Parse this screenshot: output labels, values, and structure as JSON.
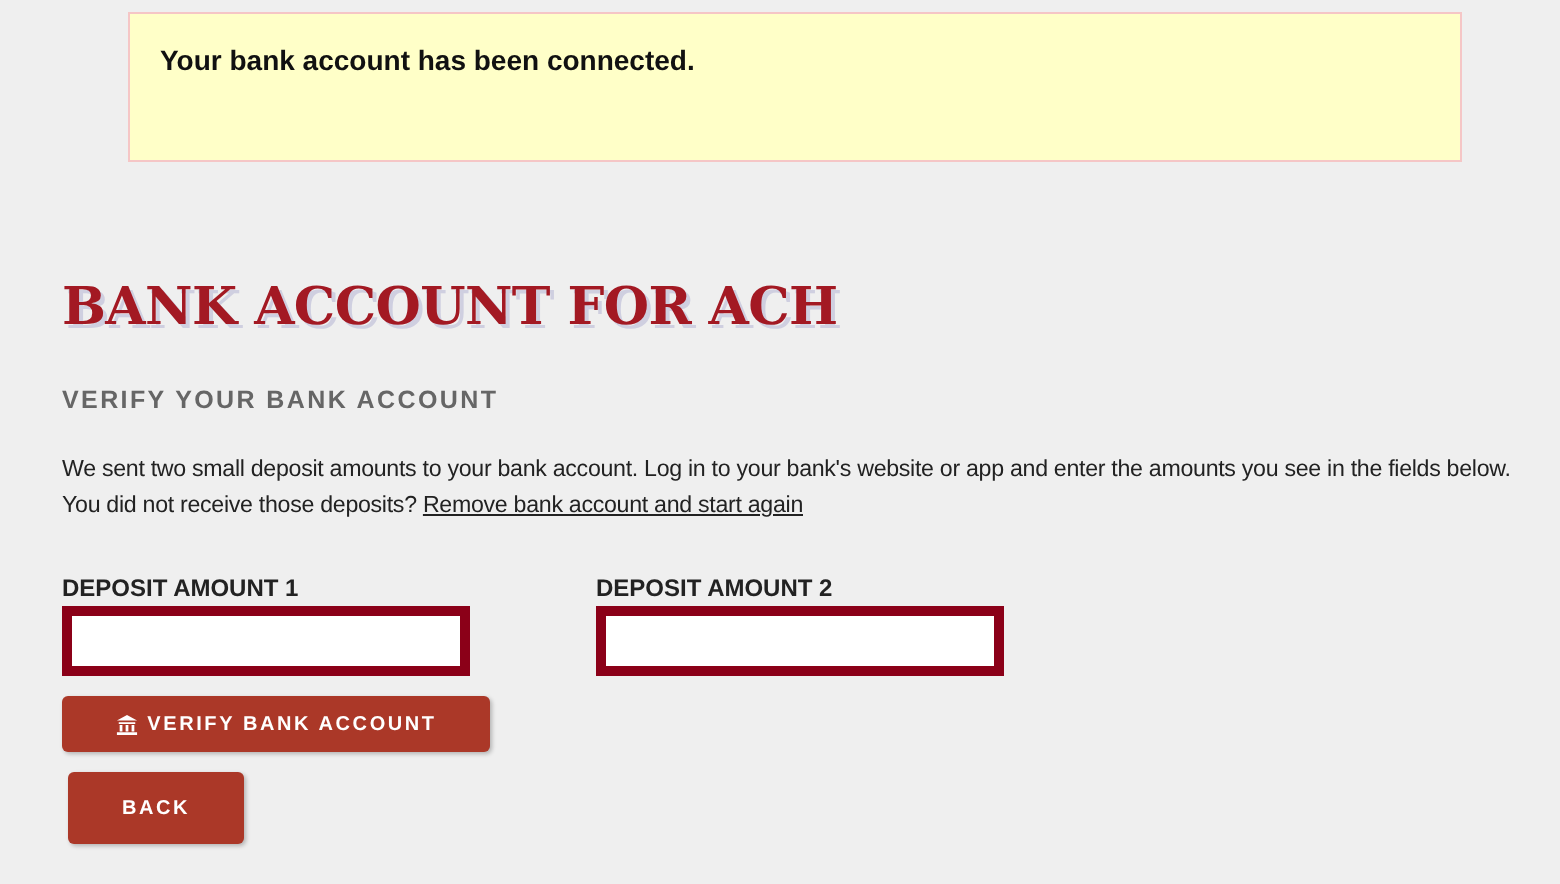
{
  "notice": {
    "message": "Your bank account has been connected."
  },
  "title": "BANK ACCOUNT FOR ACH",
  "subtitle": "VERIFY YOUR BANK ACCOUNT",
  "instructions": "We sent two small deposit amounts to your bank account. Log in to your bank's website or app and enter the amounts you see in the fields below.",
  "retry": {
    "text": "You did not receive those deposits?",
    "link": "Remove bank account and start again"
  },
  "fields": [
    {
      "label": "DEPOSIT AMOUNT 1"
    },
    {
      "label": "DEPOSIT AMOUNT 2"
    }
  ],
  "buttons": [
    {
      "kind": "verify",
      "label": "VERIFY BANK ACCOUNT"
    },
    {
      "kind": "back",
      "label": "BACK"
    }
  ]
}
